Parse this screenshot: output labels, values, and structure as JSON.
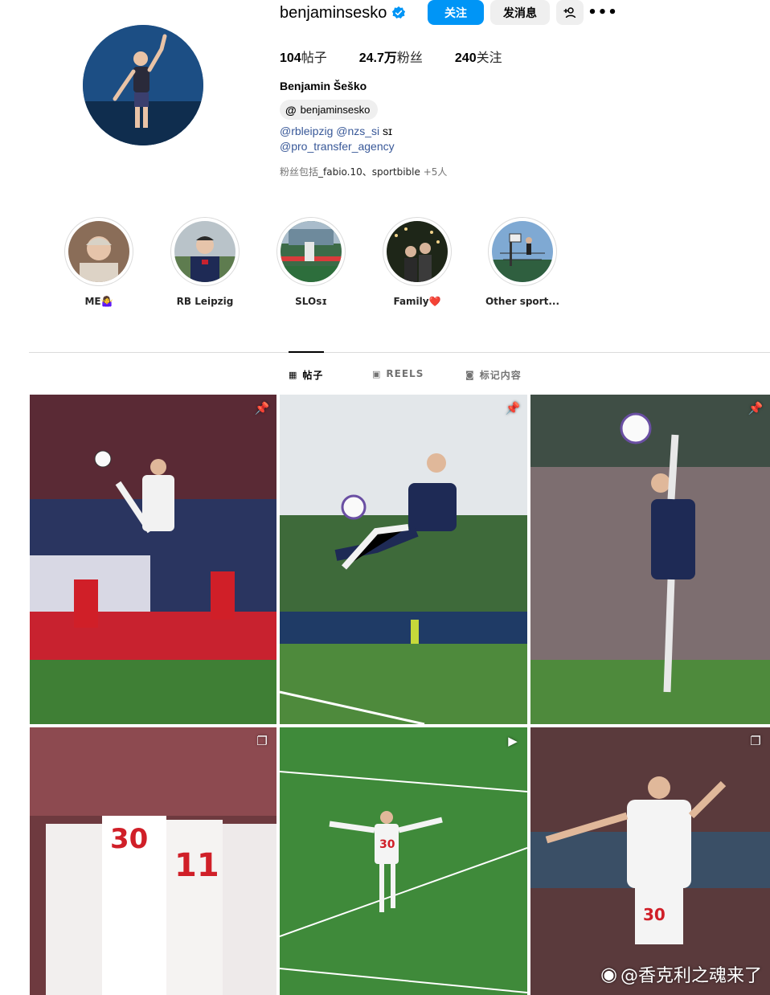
{
  "profile": {
    "username": "benjaminsesko",
    "follow_label": "关注",
    "message_label": "发消息",
    "stats": [
      {
        "value": "104",
        "label": "帖子"
      },
      {
        "value": "24.7万",
        "label": "粉丝"
      },
      {
        "value": "240",
        "label": "关注"
      }
    ],
    "full_name": "Benjamin Šeško",
    "threads_handle": "benjaminsesko",
    "bio_mentions": [
      "@rbleipzig",
      "@nzs_si"
    ],
    "bio_suffix": "sɪ",
    "bio_mention_2": "@pro_transfer_agency",
    "followed_by_prefix": "粉丝包括",
    "followed_by_names": "_fabio.10、sportbible",
    "followed_by_more": "+5人"
  },
  "highlights": [
    {
      "label": "ME🤷‍♀️"
    },
    {
      "label": "RB Leipzig"
    },
    {
      "label": "SLOsɪ"
    },
    {
      "label": "Family❤️"
    },
    {
      "label": "Other sport..."
    }
  ],
  "tabs": [
    {
      "label": "帖子",
      "icon": "grid-icon"
    },
    {
      "label": "REELS",
      "icon": "reels-icon"
    },
    {
      "label": "标记内容",
      "icon": "tagged-icon"
    }
  ],
  "posts": [
    {
      "badge": "pin-icon"
    },
    {
      "badge": "pin-icon"
    },
    {
      "badge": "pin-icon"
    },
    {
      "badge": "carousel-icon"
    },
    {
      "badge": "reel-icon"
    },
    {
      "badge": "carousel-icon"
    }
  ],
  "watermark": "@香克利之魂来了",
  "colors": {
    "accent": "#0095f6",
    "link": "#385898",
    "verified": "#0095f6"
  }
}
